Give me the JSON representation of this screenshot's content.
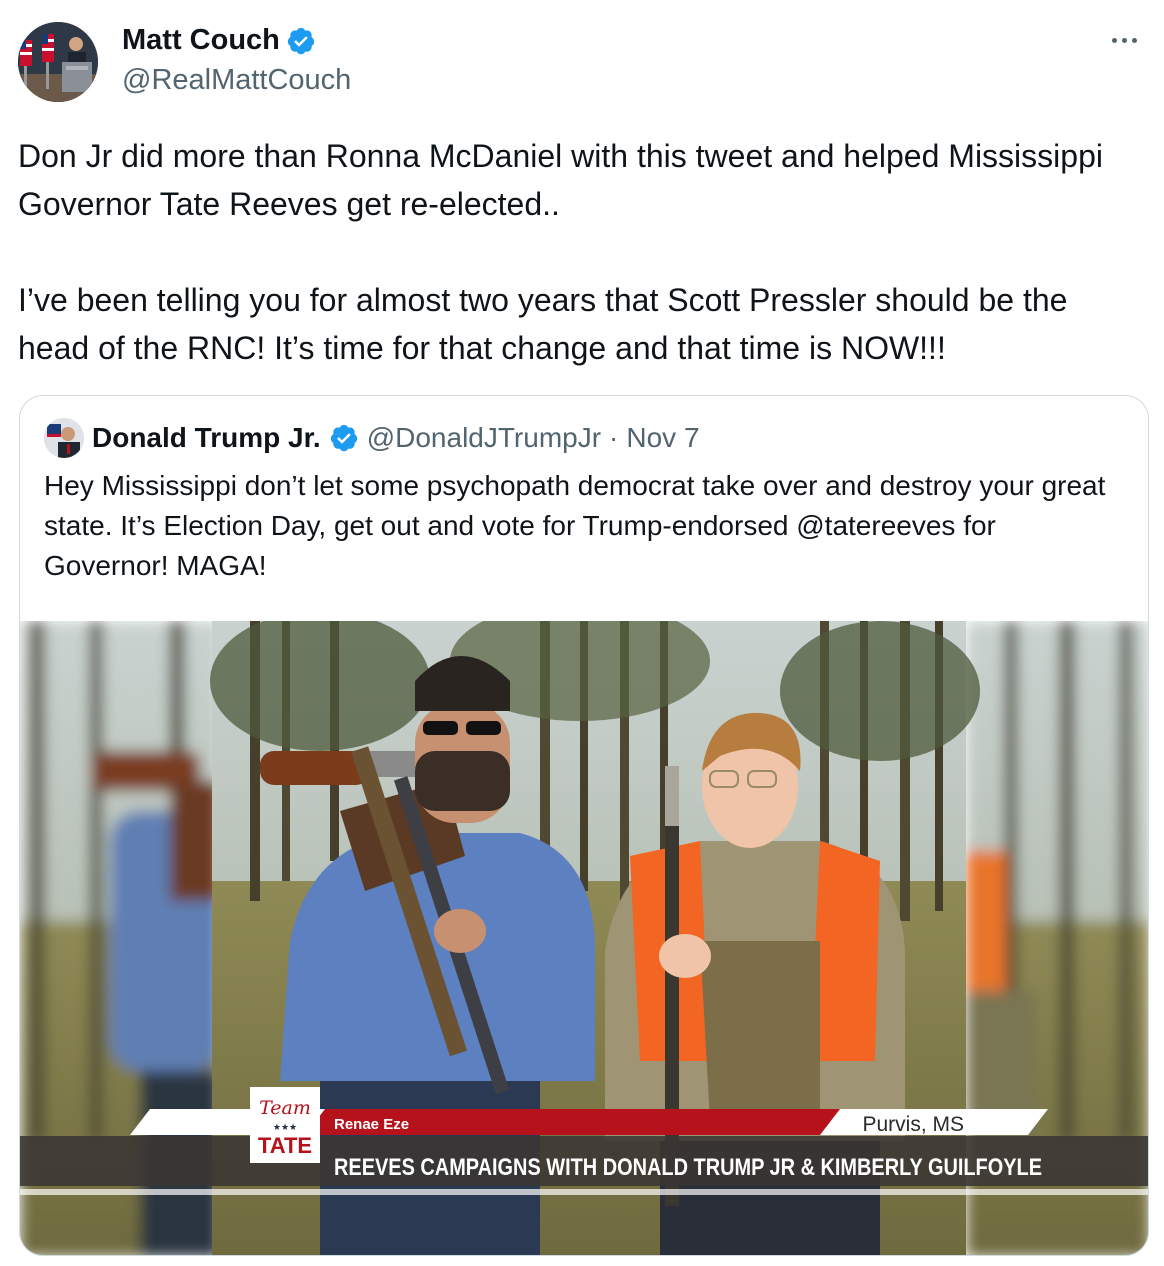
{
  "author": {
    "name": "Matt Couch",
    "handle": "@RealMattCouch",
    "verified_color": "#1d9bf0"
  },
  "tweet": {
    "text": "Don Jr did more than Ronna McDaniel with this tweet and helped Mississippi Governor Tate Reeves get re-elected..\n\nI’ve been telling you for almost two years that Scott Pressler should be the head of the RNC! It’s time for that change and that time is NOW!!!"
  },
  "quoted": {
    "name": "Donald Trump Jr.",
    "handle": "@DonaldJTrumpJr",
    "separator": "·",
    "date": "Nov 7",
    "text": "Hey Mississippi don’t let some psychopath democrat take over and destroy your great state. It’s Election Day, get out and vote for Trump-endorsed @tatereeves for Governor! MAGA!"
  },
  "media": {
    "logo_top": "Team",
    "logo_stars": "★★★",
    "logo_bottom": "TATE",
    "reporter": "Renae Eze",
    "location": "Purvis, MS",
    "headline": "REEVES CAMPAIGNS WITH DONALD TRUMP JR & KIMBERLY GUILFOYLE"
  },
  "colors": {
    "accent": "#1d9bf0",
    "text": "#0f1419",
    "muted": "#536471",
    "border": "#cfd9de",
    "banner_red": "#b5121b"
  }
}
